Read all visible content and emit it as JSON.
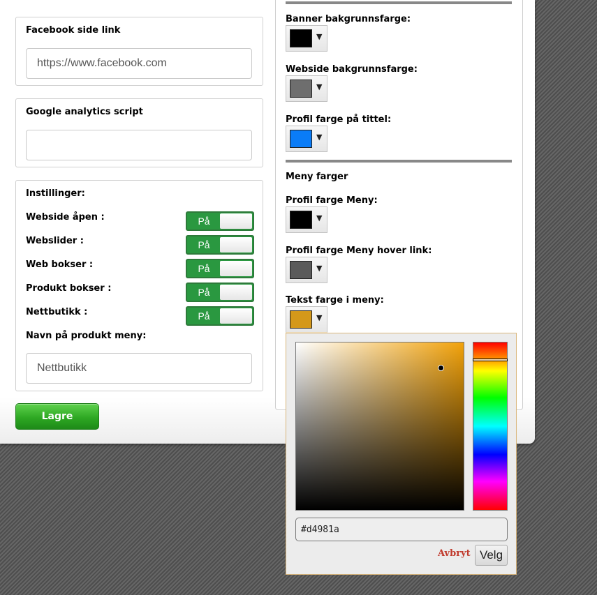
{
  "left": {
    "facebook": {
      "label": "Facebook side link",
      "value": "https://www.facebook.com"
    },
    "analytics": {
      "label": "Google analytics script",
      "value": ""
    },
    "settings": {
      "title": "Instillinger:",
      "toggles": [
        {
          "label": "Webside åpen :",
          "state": "På"
        },
        {
          "label": "Webslider :",
          "state": "På"
        },
        {
          "label": "Web bokser :",
          "state": "På"
        },
        {
          "label": "Produkt bokser :",
          "state": "På"
        },
        {
          "label": "Nettbutikk :",
          "state": "På"
        }
      ],
      "product_menu": {
        "label": "Navn på produkt meny:",
        "value": "Nettbutikk"
      }
    },
    "save_label": "Lagre"
  },
  "right": {
    "banner_bg": {
      "label": "Banner bakgrunnsfarge:",
      "color": "#000000"
    },
    "site_bg": {
      "label": "Webside bakgrunnsfarge:",
      "color": "#6e6e6e"
    },
    "title_color": {
      "label": "Profil farge på tittel:",
      "color": "#0a7cf7"
    },
    "menu_section": "Meny farger",
    "menu_color": {
      "label": "Profil farge Meny:",
      "color": "#000000"
    },
    "menu_hover": {
      "label": "Profil farge Meny hover link:",
      "color": "#5a5a5a"
    },
    "menu_text": {
      "label": "Tekst farge i meny:",
      "color": "#d4981a"
    },
    "arrow_glyph": "▼"
  },
  "picker": {
    "hex_value": "#d4981a",
    "hue_color": "#f2a20a",
    "cancel_label": "Avbryt",
    "choose_label": "Velg"
  }
}
